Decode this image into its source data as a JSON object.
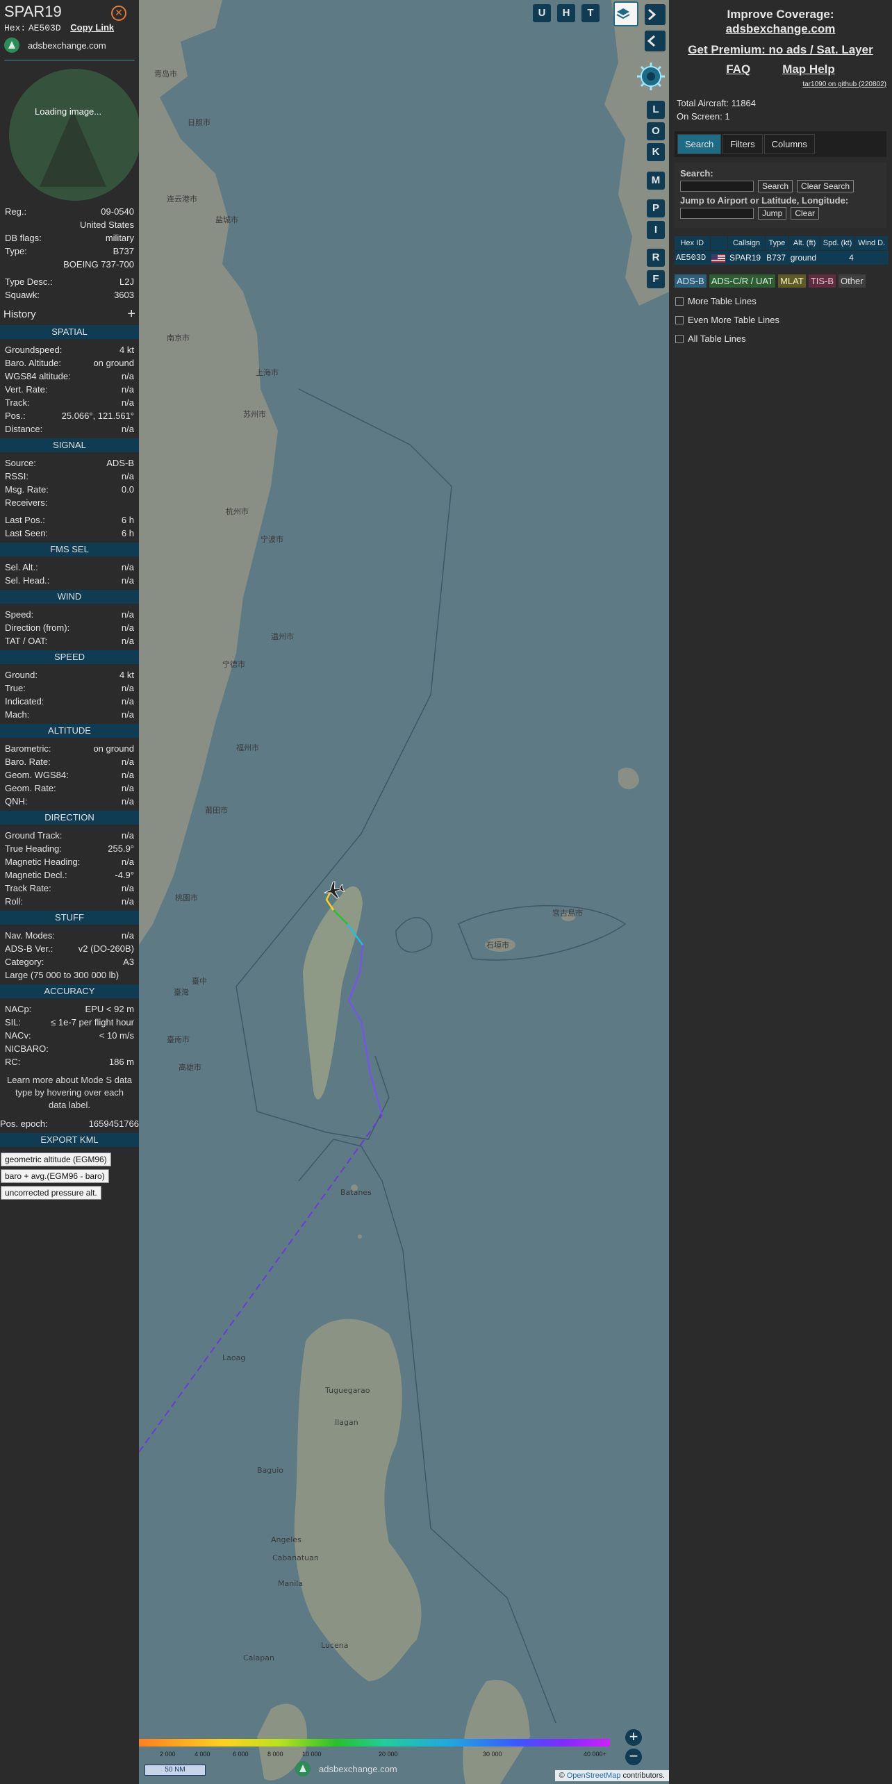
{
  "header": {
    "callsign": "SPAR19",
    "hex_label": "Hex:",
    "hex": "AE503D",
    "copy_link": "Copy Link",
    "source_site": "adsbexchange.com",
    "photo_loading": "Loading image..."
  },
  "aircraft": {
    "reg_label": "Reg.:",
    "reg": "09-0540",
    "country": "United States",
    "dbflags_label": "DB flags:",
    "dbflags": "military",
    "type_label": "Type:",
    "type": "B737",
    "type_full": "BOEING 737-700",
    "typedesc_label": "Type Desc.:",
    "typedesc": "L2J",
    "squawk_label": "Squawk:",
    "squawk": "3603"
  },
  "history": {
    "label": "History",
    "plus": "+"
  },
  "spatial": {
    "title": "SPATIAL",
    "rows": [
      {
        "k": "Groundspeed:",
        "v": "4 kt"
      },
      {
        "k": "Baro. Altitude:",
        "v": "on ground"
      },
      {
        "k": "WGS84 altitude:",
        "v": "n/a"
      },
      {
        "k": "Vert. Rate:",
        "v": "n/a"
      },
      {
        "k": "Track:",
        "v": "n/a"
      },
      {
        "k": "Pos.:",
        "v": "25.066°, 121.561°"
      },
      {
        "k": "Distance:",
        "v": "n/a"
      }
    ]
  },
  "signal": {
    "title": "SIGNAL",
    "rows": [
      {
        "k": "Source:",
        "v": "ADS-B"
      },
      {
        "k": "RSSI:",
        "v": "n/a"
      },
      {
        "k": "Msg. Rate:",
        "v": "0.0"
      },
      {
        "k": "Receivers:",
        "v": ""
      }
    ],
    "rows2": [
      {
        "k": "Last Pos.:",
        "v": "6 h"
      },
      {
        "k": "Last Seen:",
        "v": "6 h"
      }
    ]
  },
  "fms": {
    "title": "FMS SEL",
    "rows": [
      {
        "k": "Sel. Alt.:",
        "v": "n/a"
      },
      {
        "k": "Sel. Head.:",
        "v": "n/a"
      }
    ]
  },
  "wind": {
    "title": "WIND",
    "rows": [
      {
        "k": "Speed:",
        "v": "n/a"
      },
      {
        "k": "Direction (from):",
        "v": "n/a"
      },
      {
        "k": "TAT / OAT:",
        "v": "n/a"
      }
    ]
  },
  "speed": {
    "title": "SPEED",
    "rows": [
      {
        "k": "Ground:",
        "v": "4 kt"
      },
      {
        "k": "True:",
        "v": "n/a"
      },
      {
        "k": "Indicated:",
        "v": "n/a"
      },
      {
        "k": "Mach:",
        "v": "n/a"
      }
    ]
  },
  "altitude": {
    "title": "ALTITUDE",
    "rows": [
      {
        "k": "Barometric:",
        "v": "on ground"
      },
      {
        "k": "Baro. Rate:",
        "v": "n/a"
      },
      {
        "k": "Geom. WGS84:",
        "v": "n/a"
      },
      {
        "k": "Geom. Rate:",
        "v": "n/a"
      },
      {
        "k": "QNH:",
        "v": "n/a"
      }
    ]
  },
  "direction": {
    "title": "DIRECTION",
    "rows": [
      {
        "k": "Ground Track:",
        "v": "n/a"
      },
      {
        "k": "True Heading:",
        "v": "255.9°"
      },
      {
        "k": "Magnetic Heading:",
        "v": "n/a"
      },
      {
        "k": "Magnetic Decl.:",
        "v": "-4.9°"
      },
      {
        "k": "Track Rate:",
        "v": "n/a"
      },
      {
        "k": "Roll:",
        "v": "n/a"
      }
    ]
  },
  "stuff": {
    "title": "STUFF",
    "rows": [
      {
        "k": "Nav. Modes:",
        "v": "n/a"
      },
      {
        "k": "ADS-B Ver.:",
        "v": "v2 (DO-260B)"
      },
      {
        "k": "Category:",
        "v": "A3"
      }
    ],
    "category_desc": "Large (75 000 to 300 000 lb)"
  },
  "accuracy": {
    "title": "ACCURACY",
    "rows": [
      {
        "k": "NACp:",
        "v": "EPU < 92 m"
      },
      {
        "k": "SIL:",
        "v": "≤ 1e-7 per flight hour"
      },
      {
        "k": "NACv:",
        "v": "< 10 m/s"
      },
      {
        "k": "NICBARO:",
        "v": ""
      },
      {
        "k": "RC:",
        "v": "186 m"
      }
    ],
    "note": "Learn more about Mode S data type by hovering over each data label."
  },
  "epoch": {
    "k": "Pos. epoch:",
    "v": "1659451766"
  },
  "export": {
    "title": "EXPORT KML",
    "buttons": [
      "geometric altitude (EGM96)",
      "baro + avg.(EGM96 - baro)",
      "uncorrected pressure alt."
    ]
  },
  "map": {
    "top_buttons": [
      "U",
      "H",
      "T"
    ],
    "side_buttons": [
      "L",
      "O",
      "K",
      "M",
      "P",
      "I",
      "R",
      "F"
    ],
    "zoom_in": "+",
    "zoom_out": "−",
    "altitude_ticks": [
      "2 000",
      "4 000",
      "6 000",
      "8 000",
      "10 000",
      "20 000",
      "30 000",
      "40 000+"
    ],
    "scale_label": "50 NM",
    "logo_text": "adsbexchange.com",
    "attribution_prefix": "©",
    "attribution_link": "OpenStreetMap",
    "attribution_suffix": "contributors.",
    "ocean_color": "#5d7a85",
    "land_color": "#8a8f86",
    "labels": [
      {
        "t": "青岛市"
      },
      {
        "t": "日照市"
      },
      {
        "t": "连云港市"
      },
      {
        "t": "盐城市"
      },
      {
        "t": "南京市"
      },
      {
        "t": "苏州市"
      },
      {
        "t": "上海市"
      },
      {
        "t": "杭州市"
      },
      {
        "t": "宁波市"
      },
      {
        "t": "温州市"
      },
      {
        "t": "福州市"
      },
      {
        "t": "宁德市"
      },
      {
        "t": "莆田市"
      },
      {
        "t": "桃園市"
      },
      {
        "t": "臺中"
      },
      {
        "t": "臺灣"
      },
      {
        "t": "高雄市"
      },
      {
        "t": "臺南市"
      },
      {
        "t": "石垣市"
      },
      {
        "t": "宮古島市"
      },
      {
        "t": "Batanes"
      },
      {
        "t": "Laoag"
      },
      {
        "t": "Tuguegarao"
      },
      {
        "t": "Ilagan"
      },
      {
        "t": "Baguio"
      },
      {
        "t": "Angeles"
      },
      {
        "t": "Manila"
      },
      {
        "t": "Lucena"
      },
      {
        "t": "Calapan"
      },
      {
        "t": "Cabanatuan"
      }
    ]
  },
  "right": {
    "improve_title": "Improve Coverage:",
    "improve_link": "adsbexchange.com",
    "premium": "Get Premium: no ads / Sat. Layer",
    "faq": "FAQ",
    "help": "Map Help",
    "github": "tar1090 on github (220802)",
    "total_label": "Total Aircraft:",
    "total": "11864",
    "onscreen_label": "On Screen:",
    "onscreen": "1",
    "tabs": [
      "Search",
      "Filters",
      "Columns"
    ],
    "search_label": "Search:",
    "search_btn": "Search",
    "clear_search_btn": "Clear Search",
    "jump_label": "Jump to Airport or Latitude, Longitude:",
    "jump_btn": "Jump",
    "clear_btn": "Clear",
    "table": {
      "headers": [
        "Hex ID",
        "",
        "Callsign",
        "Type",
        "Alt. (ft)",
        "Spd. (kt)",
        "Wind D."
      ],
      "row": {
        "hex": "AE503D",
        "callsign": "SPAR19",
        "type": "B737",
        "alt": "ground",
        "spd": "4",
        "wind": ""
      }
    },
    "legend": [
      {
        "label": "ADS-B",
        "bg": "#2e5f78",
        "fg": "#cfe6f5"
      },
      {
        "label": "ADS-C/R / UAT",
        "bg": "#2f5d32",
        "fg": "#d8f2d8"
      },
      {
        "label": "MLAT",
        "bg": "#5f5a2a",
        "fg": "#f5eeb8"
      },
      {
        "label": "TIS-B",
        "bg": "#5d2c3f",
        "fg": "#f4c6d8"
      },
      {
        "label": "Other",
        "bg": "#404040",
        "fg": "#e0e0e0"
      }
    ],
    "checkboxes": [
      "More Table Lines",
      "Even More Table Lines",
      "All Table Lines"
    ]
  }
}
